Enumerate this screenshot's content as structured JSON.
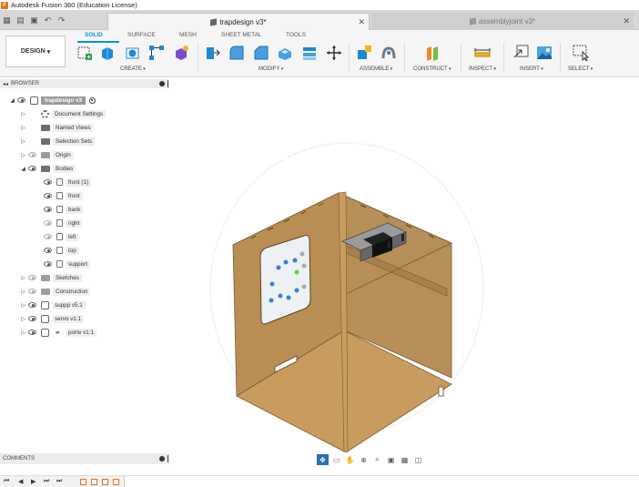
{
  "window": {
    "title": "Autodesk Fusion 360 (Education License)",
    "app_icon": "F"
  },
  "quick_access": {
    "icons": [
      "grid-menu-icon",
      "file-menu-icon",
      "save-icon",
      "undo-icon",
      "redo-icon"
    ]
  },
  "tabs": [
    {
      "label": "trapdesign v3*",
      "active": true
    },
    {
      "label": "assemblyjoint v3*",
      "active": false
    }
  ],
  "toolbar": {
    "workspace_button": "DESIGN",
    "workspace_tabs": [
      "SOLID",
      "SURFACE",
      "MESH",
      "SHEET METAL",
      "TOOLS"
    ],
    "groups": [
      "CREATE",
      "MODIFY",
      "ASSEMBLE",
      "CONSTRUCT",
      "INSPECT",
      "INSERT",
      "SELECT"
    ]
  },
  "browser": {
    "title": "BROWSER",
    "root": "trapdesign v3",
    "items": [
      {
        "label": "Document Settings",
        "icon": "gear",
        "eye": false
      },
      {
        "label": "Named Views",
        "icon": "folder",
        "eye": false
      },
      {
        "label": "Selection Sets",
        "icon": "folder",
        "eye": false
      },
      {
        "label": "Origin",
        "icon": "folder",
        "eye": "off"
      },
      {
        "label": "Bodies",
        "icon": "folder",
        "eye": "on",
        "expanded": true
      },
      {
        "label": "front (1)",
        "icon": "body",
        "eye": "on"
      },
      {
        "label": "front",
        "icon": "body",
        "eye": "on"
      },
      {
        "label": "back",
        "icon": "body",
        "eye": "on"
      },
      {
        "label": "right",
        "icon": "body",
        "eye": "off"
      },
      {
        "label": "left",
        "icon": "body",
        "eye": "off"
      },
      {
        "label": "top",
        "icon": "body",
        "eye": "on"
      },
      {
        "label": "support",
        "icon": "body",
        "eye": "on"
      },
      {
        "label": "Sketches",
        "icon": "folder",
        "eye": "off"
      },
      {
        "label": "Construction",
        "icon": "folder",
        "eye": "off"
      },
      {
        "label": "suppp v5:1",
        "icon": "component",
        "eye": "on"
      },
      {
        "label": "servo v1:1",
        "icon": "component",
        "eye": "on"
      },
      {
        "label": "porte v1:1",
        "icon": "link-component",
        "eye": "on"
      }
    ]
  },
  "comments": {
    "title": "COMMENTS"
  },
  "navbar": {
    "icons": [
      "fit-grid-icon",
      "print-icon",
      "pan-hand-icon",
      "zoom-orbit-icon",
      "zoom-icon",
      "display-settings-icon",
      "grid-settings-icon",
      "viewports-icon"
    ]
  },
  "timeline": {
    "controls": [
      "first-step-icon",
      "prev-step-icon",
      "play-icon",
      "next-step-icon",
      "last-step-icon"
    ]
  },
  "colors": {
    "accent": "#0696d7",
    "wood": "#b58a50",
    "brand": "#e8731a"
  }
}
